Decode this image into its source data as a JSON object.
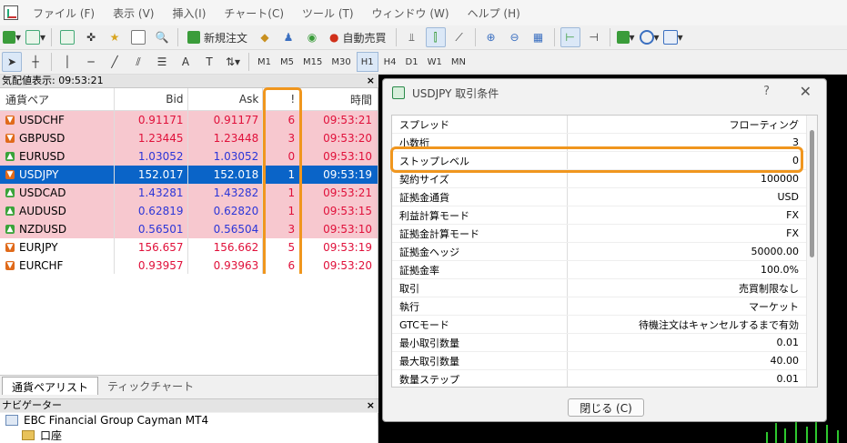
{
  "menu": {
    "items": [
      "ファイル (F)",
      "表示 (V)",
      "挿入(I)",
      "チャート(C)",
      "ツール (T)",
      "ウィンドウ (W)",
      "ヘルプ (H)"
    ]
  },
  "toolbar1": {
    "new_order_label": "新規注文",
    "auto_trade_label": "自動売買"
  },
  "toolbar2": {
    "timeframes": [
      "M1",
      "M5",
      "M15",
      "M30",
      "H1",
      "H4",
      "D1",
      "W1",
      "MN"
    ],
    "active_timeframe": "H1"
  },
  "market_watch": {
    "title": "気配値表示: 09:53:21",
    "close": "×",
    "headers": {
      "symbol": "通貨ペア",
      "bid": "Bid",
      "ask": "Ask",
      "bang": "!",
      "time": "時間"
    },
    "rows": [
      {
        "symbol": "USDCHF",
        "bid": "0.91171",
        "ask": "0.91177",
        "bang": "6",
        "time": "09:53:21",
        "dir": "down"
      },
      {
        "symbol": "GBPUSD",
        "bid": "1.23445",
        "ask": "1.23448",
        "bang": "3",
        "time": "09:53:20",
        "dir": "down"
      },
      {
        "symbol": "EURUSD",
        "bid": "1.03052",
        "ask": "1.03052",
        "bang": "0",
        "time": "09:53:10",
        "dir": "up"
      },
      {
        "symbol": "USDJPY",
        "bid": "152.017",
        "ask": "152.018",
        "bang": "1",
        "time": "09:53:19",
        "dir": "down"
      },
      {
        "symbol": "USDCAD",
        "bid": "1.43281",
        "ask": "1.43282",
        "bang": "1",
        "time": "09:53:21",
        "dir": "up"
      },
      {
        "symbol": "AUDUSD",
        "bid": "0.62819",
        "ask": "0.62820",
        "bang": "1",
        "time": "09:53:15",
        "dir": "up"
      },
      {
        "symbol": "NZDUSD",
        "bid": "0.56501",
        "ask": "0.56504",
        "bang": "3",
        "time": "09:53:10",
        "dir": "up"
      },
      {
        "symbol": "EURJPY",
        "bid": "156.657",
        "ask": "156.662",
        "bang": "5",
        "time": "09:53:19",
        "dir": "down"
      },
      {
        "symbol": "EURCHF",
        "bid": "0.93957",
        "ask": "0.93963",
        "bang": "6",
        "time": "09:53:20",
        "dir": "down"
      }
    ],
    "tabs": [
      "通貨ペアリスト",
      "ティックチャート"
    ]
  },
  "navigator": {
    "title": "ナビゲーター",
    "close": "×",
    "broker": "EBC Financial Group Cayman MT4",
    "account": "口座"
  },
  "dialog": {
    "title": "USDJPY 取引条件",
    "help": "?",
    "close_x": "✕",
    "close_button": "閉じる (C)",
    "properties": [
      {
        "key": "スプレッド",
        "value": "フローティング"
      },
      {
        "key": "小数桁",
        "value": "3"
      },
      {
        "key": "ストップレベル",
        "value": "0"
      },
      {
        "key": "契約サイズ",
        "value": "100000"
      },
      {
        "key": "証拠金通貨",
        "value": "USD"
      },
      {
        "key": "利益計算モード",
        "value": "FX"
      },
      {
        "key": "証拠金計算モード",
        "value": "FX"
      },
      {
        "key": "証拠金ヘッジ",
        "value": "50000.00"
      },
      {
        "key": "証拠金率",
        "value": "100.0%"
      },
      {
        "key": "取引",
        "value": "売買制限なし"
      },
      {
        "key": "執行",
        "value": "マーケット"
      },
      {
        "key": "GTCモード",
        "value": "待機注文はキャンセルするまで有効"
      },
      {
        "key": "最小取引数量",
        "value": "0.01"
      },
      {
        "key": "最大取引数量",
        "value": "40.00"
      },
      {
        "key": "数量ステップ",
        "value": "0.01"
      }
    ]
  },
  "colors": {
    "highlight": "#f0961e",
    "row_red": "#f7c8cf",
    "selected": "#0a64c8",
    "price_red": "#e0103a",
    "price_blue": "#2c36d8"
  }
}
